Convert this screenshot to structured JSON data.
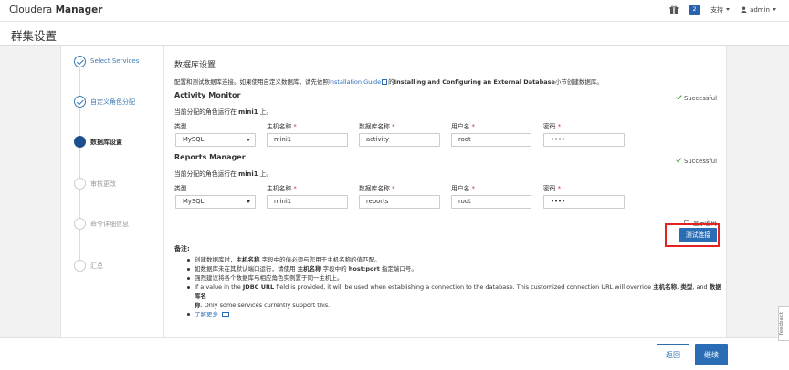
{
  "navbar": {
    "brand_prefix": "Cloudera",
    "brand_suffix": "Manager",
    "badge_count": "2",
    "support_label": "支持",
    "user_label": "admin"
  },
  "header": {
    "title": "群集设置"
  },
  "steps": [
    {
      "label": "Select Services",
      "state": "done"
    },
    {
      "label": "自定义角色分配",
      "state": "done"
    },
    {
      "label": "数据库设置",
      "state": "active"
    },
    {
      "label": "审核更改",
      "state": "pending"
    },
    {
      "label": "命令详细信息",
      "state": "pending"
    },
    {
      "label": "汇总",
      "state": "pending"
    }
  ],
  "main": {
    "title": "数据库设置",
    "intro_before": "配置和测试数据库连接。如果使用自定义数据库，请先依照",
    "intro_link": "Installation Guide",
    "intro_mid": "的",
    "intro_bold": "Installing and Configuring an External Database",
    "intro_after": "小节创建数据库。"
  },
  "field_labels": {
    "type": "类型",
    "host": "主机名称",
    "dbname": "数据库名称",
    "user": "用户名",
    "password": "密码",
    "required_mark": "*"
  },
  "groups": [
    {
      "title": "Activity Monitor",
      "status": "Successful",
      "host_note_before": "当前分配的角色运行在",
      "host_note_host": "mini1",
      "host_note_after": "上。",
      "type": "MySQL",
      "host": "mini1",
      "dbname": "activity",
      "user": "root",
      "password": "••••"
    },
    {
      "title": "Reports Manager",
      "status": "Successful",
      "host_note_before": "当前分配的角色运行在",
      "host_note_host": "mini1",
      "host_note_after": "上。",
      "type": "MySQL",
      "host": "mini1",
      "dbname": "reports",
      "user": "root",
      "password": "••••"
    }
  ],
  "show_password_label": "显示密码",
  "test_button": "测试连接",
  "notes": {
    "title": "备注:",
    "n1_a": "创建数据库时，",
    "n1_b": "主机名称",
    "n1_c": "字段中的值必须与您用于主机名称的值匹配。",
    "n2_a": "如数据库未在其默认端口运行，请使用",
    "n2_b": "主机名称",
    "n2_c": "字段中的",
    "n2_d": "host:port",
    "n2_e": "指定端口号。",
    "n3": "强烈建议将各个数据库与相应角色实例置于同一主机上。",
    "n4_a": "If a value in the",
    "n4_b": "JDBC URL",
    "n4_c": "field is provided, it will be used when establishing a connection to the database. This customized connection URL will override",
    "n4_d": "主机名称",
    "n4_e": ",",
    "n4_f": "类型",
    "n4_g": ", and",
    "n4_h": "数据库名",
    "n4_i": "称",
    "n4_j": ". Only some services currently support this.",
    "more": "了解更多"
  },
  "footer": {
    "back": "返回",
    "next": "继续"
  },
  "feedback": "Feedback",
  "colors": {
    "primary": "#2a6db5",
    "highlight_frame": "#e32222",
    "success": "#3b9d3b"
  }
}
